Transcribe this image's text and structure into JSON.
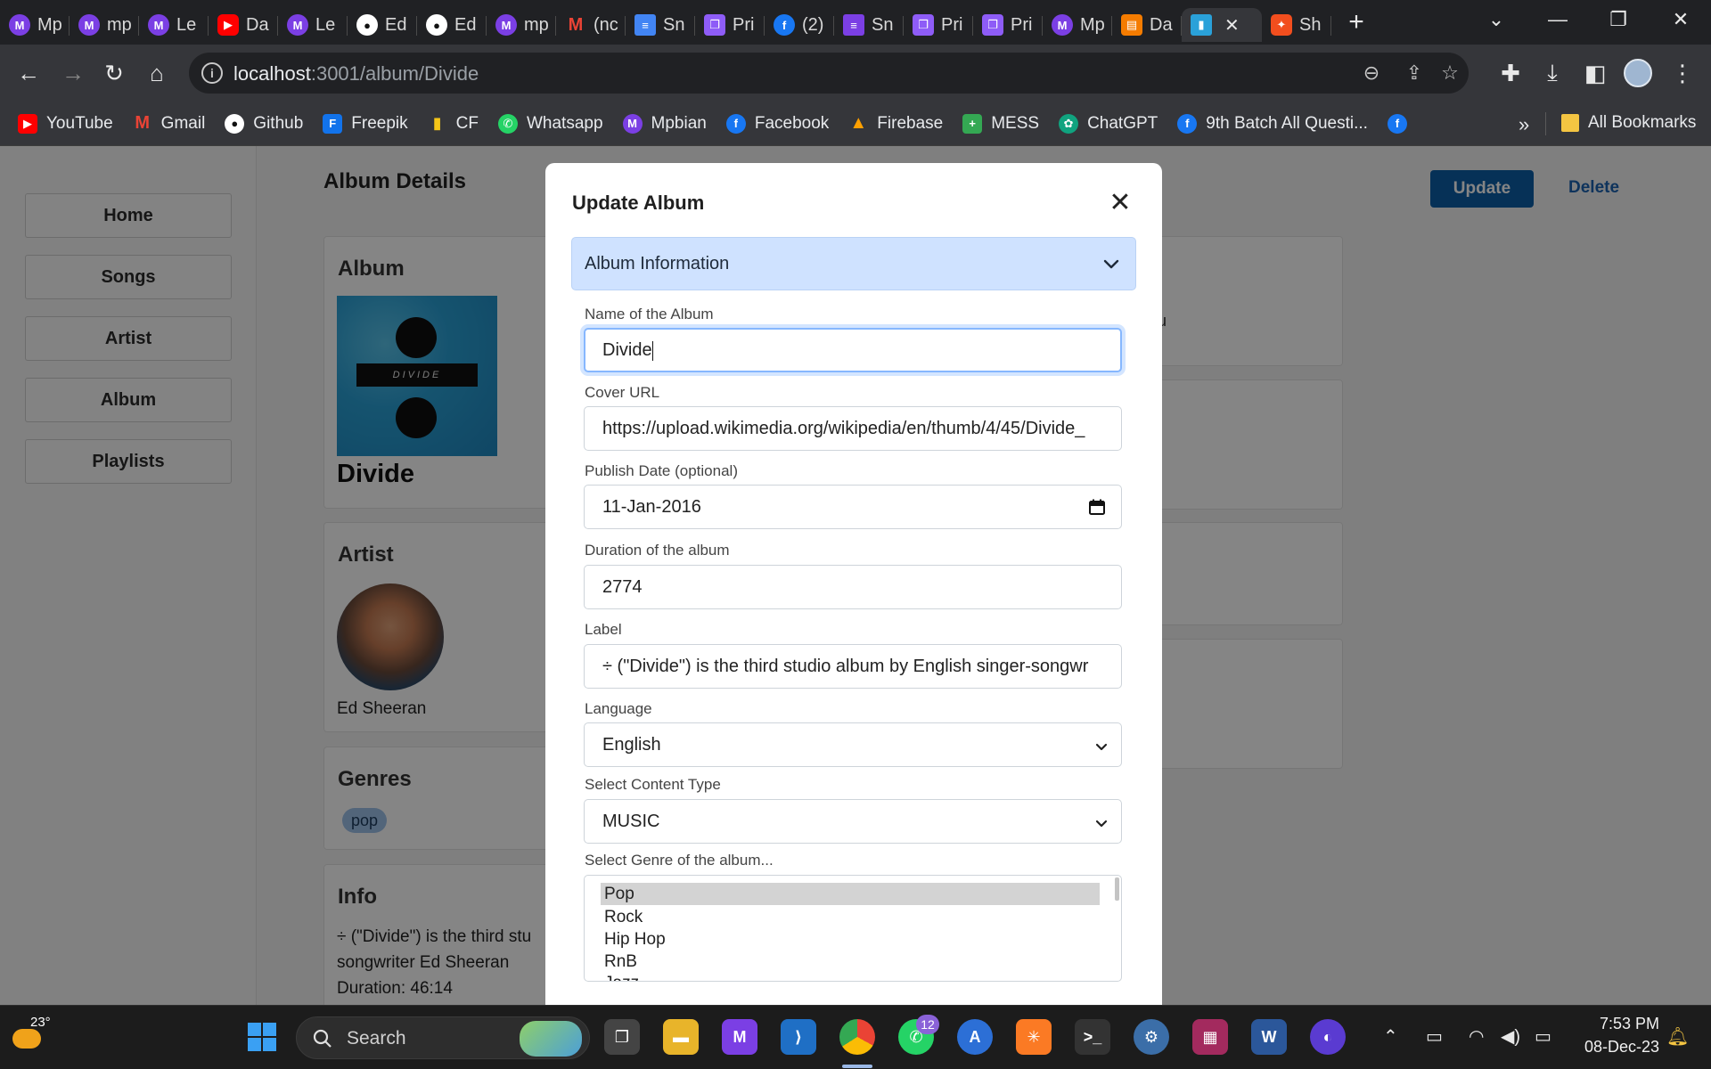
{
  "browser": {
    "tabs": [
      {
        "label": "Mp",
        "icon": "mpbian-icon",
        "color": "#7b3fe4"
      },
      {
        "label": "mp",
        "icon": "mpbian-icon",
        "color": "#7b3fe4"
      },
      {
        "label": "Le",
        "icon": "mpbian-icon",
        "color": "#7b3fe4"
      },
      {
        "label": "Da",
        "icon": "youtube-icon",
        "color": "#ff0000"
      },
      {
        "label": "Le",
        "icon": "mpbian-icon",
        "color": "#7b3fe4"
      },
      {
        "label": "Ed",
        "icon": "github-icon",
        "color": "#ffffff"
      },
      {
        "label": "Ed",
        "icon": "github-icon",
        "color": "#ffffff"
      },
      {
        "label": "mp",
        "icon": "mpbian-icon",
        "color": "#7b3fe4"
      },
      {
        "label": "(nc",
        "icon": "gmail-icon",
        "color": "#ea4335"
      },
      {
        "label": "Sn",
        "icon": "docs-icon",
        "color": "#4285f4"
      },
      {
        "label": "Pri",
        "icon": "copy-icon",
        "color": "#8e5cf7"
      },
      {
        "label": "(2)",
        "icon": "facebook-icon",
        "color": "#1877f2"
      },
      {
        "label": "Sn",
        "icon": "list-icon",
        "color": "#7b3fe4"
      },
      {
        "label": "Pri",
        "icon": "copy-icon",
        "color": "#8e5cf7"
      },
      {
        "label": "Pri",
        "icon": "copy-icon",
        "color": "#8e5cf7"
      },
      {
        "label": "Mp",
        "icon": "mpbian-icon",
        "color": "#7b3fe4"
      },
      {
        "label": "Da",
        "icon": "chat-icon",
        "color": "#f57c00"
      },
      {
        "label": "",
        "icon": "app-icon",
        "color": "#2aa1d9",
        "active": true
      },
      {
        "label": "Sh",
        "icon": "figma-icon",
        "color": "#f24e1e"
      }
    ],
    "url_host": "localhost",
    "url_path": ":3001/album/Divide",
    "bookmarks": [
      {
        "label": "YouTube",
        "icon": "youtube-icon",
        "color": "#ff0000"
      },
      {
        "label": "Gmail",
        "icon": "gmail-icon",
        "color": "#ea4335"
      },
      {
        "label": "Github",
        "icon": "github-icon",
        "color": "#ffffff"
      },
      {
        "label": "Freepik",
        "icon": "freepik-icon",
        "color": "#1273eb"
      },
      {
        "label": "CF",
        "icon": "codeforces-icon",
        "color": "#f5c518"
      },
      {
        "label": "Whatsapp",
        "icon": "whatsapp-icon",
        "color": "#25d366"
      },
      {
        "label": "Mpbian",
        "icon": "mpbian-icon",
        "color": "#7b3fe4"
      },
      {
        "label": "Facebook",
        "icon": "facebook-icon",
        "color": "#1877f2"
      },
      {
        "label": "Firebase",
        "icon": "firebase-icon",
        "color": "#ffa000"
      },
      {
        "label": "MESS",
        "icon": "plus-icon",
        "color": "#34a853"
      },
      {
        "label": "ChatGPT",
        "icon": "chatgpt-icon",
        "color": "#10a37f"
      },
      {
        "label": "9th Batch All Questi...",
        "icon": "facebook-icon",
        "color": "#1877f2"
      },
      {
        "label": "",
        "icon": "facebook-icon",
        "color": "#1877f2"
      }
    ],
    "more_bookmarks": "»",
    "all_bookmarks": "All Bookmarks"
  },
  "sidebar": {
    "items": [
      {
        "label": "Home"
      },
      {
        "label": "Songs"
      },
      {
        "label": "Artist"
      },
      {
        "label": "Album"
      },
      {
        "label": "Playlists"
      }
    ]
  },
  "main": {
    "title": "Album Details",
    "album_heading": "Album",
    "album_name": "Divide",
    "cover_text": "DIVIDE",
    "artist_heading": "Artist",
    "artist_name": "Ed Sheeran",
    "genres_heading": "Genres",
    "genre_tag": "pop",
    "info_heading": "Info",
    "info_line1": "÷ (\"Divide\") is the third stu",
    "info_line2": "songwriter Ed Sheeran",
    "info_line3": "Duration: 46:14",
    "right_partial": "u",
    "update_label": "Update",
    "delete_label": "Delete"
  },
  "modal": {
    "title": "Update Album",
    "accordion_label": "Album Information",
    "fields": {
      "name": {
        "label": "Name of the Album",
        "value": "Divide"
      },
      "cover": {
        "label": "Cover URL",
        "value": "https://upload.wikimedia.org/wikipedia/en/thumb/4/45/Divide_"
      },
      "date": {
        "label": "Publish Date (optional)",
        "value": "11-Jan-2016"
      },
      "duration": {
        "label": "Duration of the album",
        "value": "2774"
      },
      "label": {
        "label": "Label",
        "value": "÷ (\"Divide\") is the third studio album by English singer-songwr"
      },
      "language": {
        "label": "Language",
        "value": "English"
      },
      "content_type": {
        "label": "Select Content Type",
        "value": "MUSIC"
      },
      "genre": {
        "label": "Select Genre of the album...",
        "options": [
          "Pop",
          "Rock",
          "Hip Hop",
          "RnB",
          "Jazz"
        ],
        "selected": "Pop"
      }
    }
  },
  "taskbar": {
    "weather_temp": "23°",
    "search_label": "Search",
    "whatsapp_badge": "12",
    "time": "7:53 PM",
    "date": "08-Dec-23"
  },
  "colors": {
    "accent": "#0d5fa8",
    "accordion_bg": "#cfe2ff",
    "focus_ring": "#86b7fe"
  }
}
